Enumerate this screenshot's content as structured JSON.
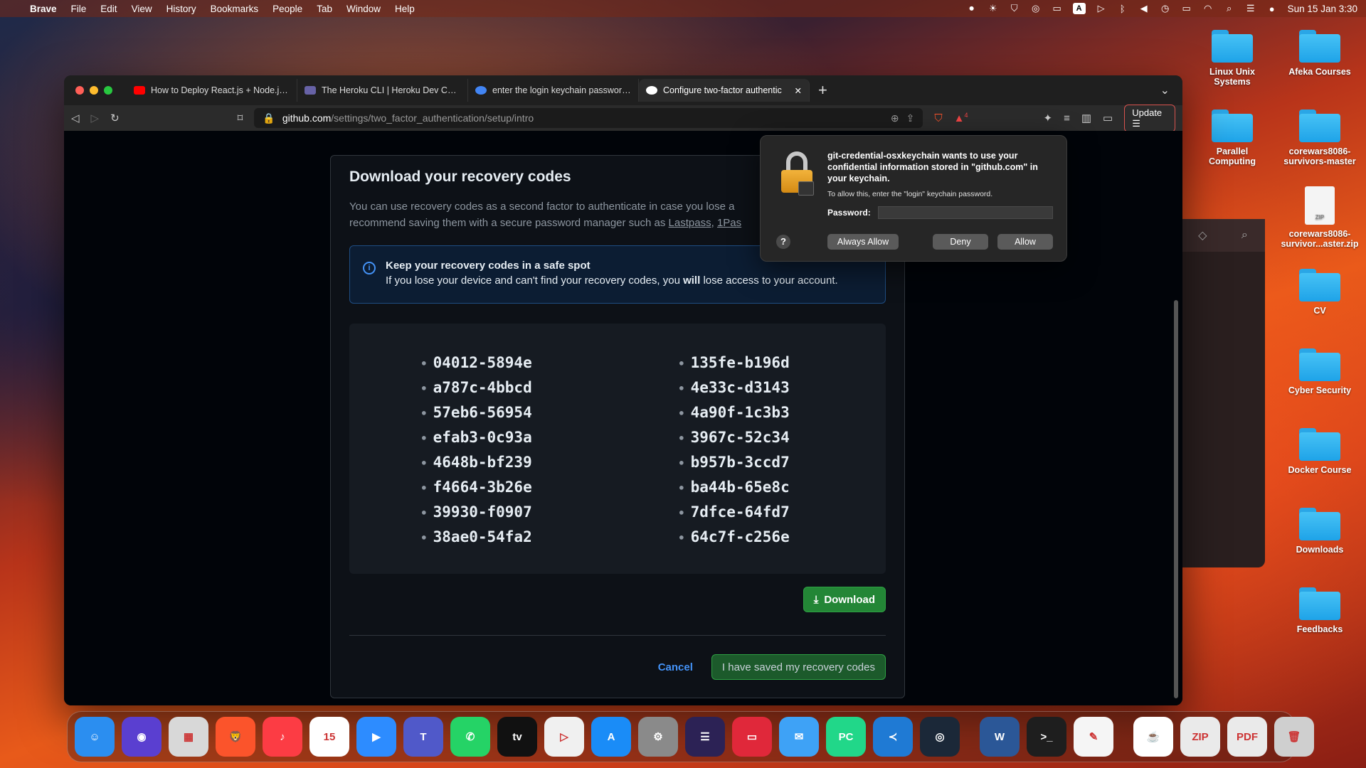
{
  "menubar": {
    "app_name": "Brave",
    "items": [
      "File",
      "Edit",
      "View",
      "History",
      "Bookmarks",
      "People",
      "Tab",
      "Window",
      "Help"
    ],
    "status_icons": [
      "screen-record-icon",
      "brightness-icon",
      "vpn-icon",
      "airdrop-icon",
      "display-icon",
      "input-source-icon",
      "play-icon",
      "bluetooth-icon",
      "volume-icon",
      "time-machine-icon",
      "battery-icon",
      "wifi-icon",
      "spotlight-icon",
      "control-center-icon",
      "siri-icon"
    ],
    "input_source": "A",
    "clock": "Sun 15 Jan  3:30"
  },
  "desktop": {
    "icons": [
      {
        "label": "Linux Unix Systems",
        "kind": "folder"
      },
      {
        "label": "Afeka Courses",
        "kind": "folder"
      },
      {
        "label": "Parallel Computing",
        "kind": "folder"
      },
      {
        "label": "corewars8086-survivors-master",
        "kind": "folder"
      },
      {
        "label": "corewars8086-survivor...aster.zip",
        "kind": "zip"
      },
      {
        "label": "CV",
        "kind": "folder"
      },
      {
        "label": "Cyber Security",
        "kind": "folder"
      },
      {
        "label": "Docker Course",
        "kind": "folder"
      },
      {
        "label": "Downloads",
        "kind": "folder"
      },
      {
        "label": "Feedbacks",
        "kind": "folder"
      }
    ]
  },
  "browser": {
    "tabs": [
      {
        "title": "How to Deploy React.js + Node.js E",
        "favicon_color": "#ff0000"
      },
      {
        "title": "The Heroku CLI | Heroku Dev Cente",
        "favicon_color": "#6762a6"
      },
      {
        "title": "enter the login keychain password g",
        "favicon_color": "#4285f4"
      },
      {
        "title": "Configure two-factor authentic",
        "favicon_color": "#ffffff"
      }
    ],
    "new_tab": "+",
    "url_host": "github.com",
    "url_path": "/settings/two_factor_authentication/setup/intro",
    "update_label": "Update",
    "shields_count": "4"
  },
  "page": {
    "heading": "Download your recovery codes",
    "description_prefix": "You can use recovery codes as a second factor to authenticate in case you lose a",
    "description_line2": "recommend saving them with a secure password manager such as",
    "link_lastpass": "Lastpass",
    "link_1password": "1Pas",
    "flash_title": "Keep your recovery codes in a safe spot",
    "flash_body_pre": "If you lose your device and can't find your recovery codes, you",
    "flash_body_bold": "will",
    "flash_body_post": "lose access to your account.",
    "codes_left": [
      "04012-5894e",
      "a787c-4bbcd",
      "57eb6-56954",
      "efab3-0c93a",
      "4648b-bf239",
      "f4664-3b26e",
      "39930-f0907",
      "38ae0-54fa2"
    ],
    "codes_right": [
      "135fe-b196d",
      "4e33c-d3143",
      "4a90f-1c3b3",
      "3967c-52c34",
      "b957b-3ccd7",
      "ba44b-65e8c",
      "7dfce-64fd7",
      "64c7f-c256e"
    ],
    "download_label": "Download",
    "cancel_label": "Cancel",
    "saved_label": "I have saved my recovery codes"
  },
  "keychain_dialog": {
    "title": "git-credential-osxkeychain wants to use your confidential information stored in \"github.com\" in your keychain.",
    "subtitle": "To allow this, enter the \"login\" keychain password.",
    "password_label": "Password:",
    "password_value": "",
    "help_label": "?",
    "always_allow_label": "Always Allow",
    "deny_label": "Deny",
    "allow_label": "Allow"
  },
  "dock": {
    "apps": [
      {
        "name": "Finder",
        "icon": "finder-icon",
        "color": "#2b8ef0",
        "glyph": "☺"
      },
      {
        "name": "Siri",
        "icon": "siri-icon",
        "color": "#5a3fd0",
        "glyph": "◉"
      },
      {
        "name": "Launchpad",
        "icon": "launchpad-icon",
        "color": "#d8d8d8",
        "glyph": "▦"
      },
      {
        "name": "Brave",
        "icon": "brave-icon",
        "color": "#fb542b",
        "glyph": "🦁"
      },
      {
        "name": "Music",
        "icon": "music-icon",
        "color": "#fc3c44",
        "glyph": "♪"
      },
      {
        "name": "Calendar",
        "icon": "calendar-icon",
        "color": "#ffffff",
        "glyph": "15"
      },
      {
        "name": "Zoom",
        "icon": "zoom-icon",
        "color": "#2d8cff",
        "glyph": "▶"
      },
      {
        "name": "Teams",
        "icon": "teams-icon",
        "color": "#5059c9",
        "glyph": "T"
      },
      {
        "name": "WhatsApp",
        "icon": "whatsapp-icon",
        "color": "#25d366",
        "glyph": "✆"
      },
      {
        "name": "Apple TV",
        "icon": "tv-icon",
        "color": "#111111",
        "glyph": "tv"
      },
      {
        "name": "Infuse",
        "icon": "play-icon",
        "color": "#f0f0f0",
        "glyph": "▷"
      },
      {
        "name": "App Store",
        "icon": "app-store-icon",
        "color": "#1a8cf7",
        "glyph": "A"
      },
      {
        "name": "System Settings",
        "icon": "settings-icon",
        "color": "#8a8a8a",
        "glyph": "⚙"
      },
      {
        "name": "Eclipse",
        "icon": "eclipse-icon",
        "color": "#2c2255",
        "glyph": "☰"
      },
      {
        "name": "Parallels",
        "icon": "parallels-icon",
        "color": "#e0283a",
        "glyph": "▭"
      },
      {
        "name": "Mail",
        "icon": "mail-icon",
        "color": "#3ea2f6",
        "glyph": "✉"
      },
      {
        "name": "PyCharm",
        "icon": "pycharm-icon",
        "color": "#21d789",
        "glyph": "PC"
      },
      {
        "name": "VS Code",
        "icon": "vscode-icon",
        "color": "#1f7ad4",
        "glyph": "≺"
      },
      {
        "name": "Steam",
        "icon": "steam-icon",
        "color": "#1b2838",
        "glyph": "◎"
      },
      {
        "name": "Word",
        "icon": "word-icon",
        "color": "#2b5797",
        "glyph": "W"
      },
      {
        "name": "Terminal",
        "icon": "terminal-icon",
        "color": "#1e1e1e",
        "glyph": ">_"
      },
      {
        "name": "TextEdit",
        "icon": "textedit-icon",
        "color": "#f5f5f5",
        "glyph": "✎"
      },
      {
        "name": "Coffee",
        "icon": "coffee-icon",
        "color": "#ffffff",
        "glyph": "☕"
      },
      {
        "name": "Zip",
        "icon": "zip-file-icon",
        "color": "#eaeaea",
        "glyph": "ZIP"
      },
      {
        "name": "PDF",
        "icon": "pdf-file-icon",
        "color": "#eaeaea",
        "glyph": "PDF"
      },
      {
        "name": "Trash",
        "icon": "trash-icon",
        "color": "#cfcfcf",
        "glyph": "🗑"
      }
    ]
  }
}
